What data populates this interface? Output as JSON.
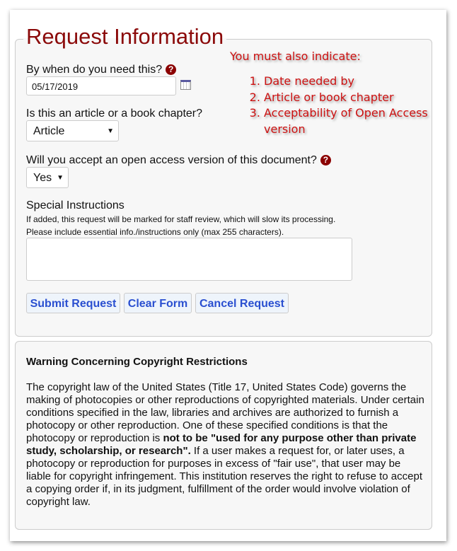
{
  "form": {
    "title": "Request Information",
    "date_label": "By when do you need this?",
    "date_value": "05/17/2019",
    "type_label": "Is this an article or a book chapter?",
    "type_value": "Article",
    "oa_label": "Will you accept an open access version of this document?",
    "oa_value": "Yes",
    "special_label": "Special Instructions",
    "special_note1": "If added, this request will be marked for staff review, which will slow its processing.",
    "special_note2": "Please include essential info./instructions only (max 255 characters).",
    "special_value": "",
    "help_glyph": "?",
    "buttons": {
      "submit": "Submit Request",
      "clear": "Clear Form",
      "cancel": "Cancel Request"
    },
    "accent_color": "#8b0a0a",
    "button_text_color": "#2a4fd0"
  },
  "annotation": {
    "heading": "You must also indicate:",
    "items": [
      "Date needed by",
      "Article or book chapter",
      "Acceptability of Open Access version"
    ],
    "color": "#cc1111"
  },
  "copyright": {
    "title": "Warning Concerning Copyright Restrictions",
    "text_before": "The copyright law of the United States (Title 17, United States Code) governs the making of photocopies or other reproductions of copyrighted materials. Under certain conditions specified in the law, libraries and archives are authorized to furnish a photocopy or other reproduction. One of these specified conditions is that the photocopy or reproduction is ",
    "text_bold": "not to be \"used for any purpose other than private study, scholarship, or research\".",
    "text_after": " If a user makes a request for, or later uses, a photocopy or reproduction for purposes in excess of \"fair use\", that user may be liable for copyright infringement. This institution reserves the right to refuse to accept a copying order if, in its judgment, fulfillment of the order would involve violation of copyright law."
  }
}
